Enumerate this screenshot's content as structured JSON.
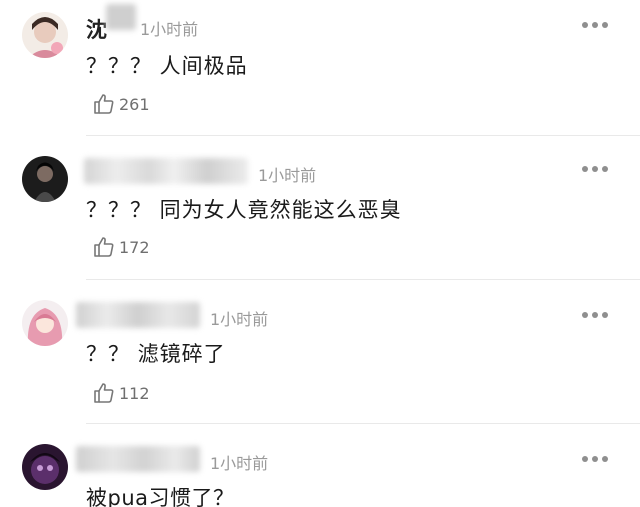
{
  "comments": [
    {
      "name_visible": "沈",
      "time": "1小时前",
      "text": "？？？ 人间极品",
      "likes": "261",
      "icon": "thumbs-up-icon"
    },
    {
      "time": "1小时前",
      "text": "？？？ 同为女人竟然能这么恶臭",
      "likes": "172",
      "icon": "thumbs-up-icon"
    },
    {
      "time": "1小时前",
      "text": "？？ 滤镜碎了",
      "likes": "112",
      "icon": "thumbs-up-icon"
    },
    {
      "time": "1小时前",
      "text": "被pua习惯了？"
    }
  ],
  "colors": {
    "time": "#9a9a9a",
    "text": "#1a1a1a",
    "like": "#6f6f6f",
    "divider": "#e9e9e9"
  }
}
